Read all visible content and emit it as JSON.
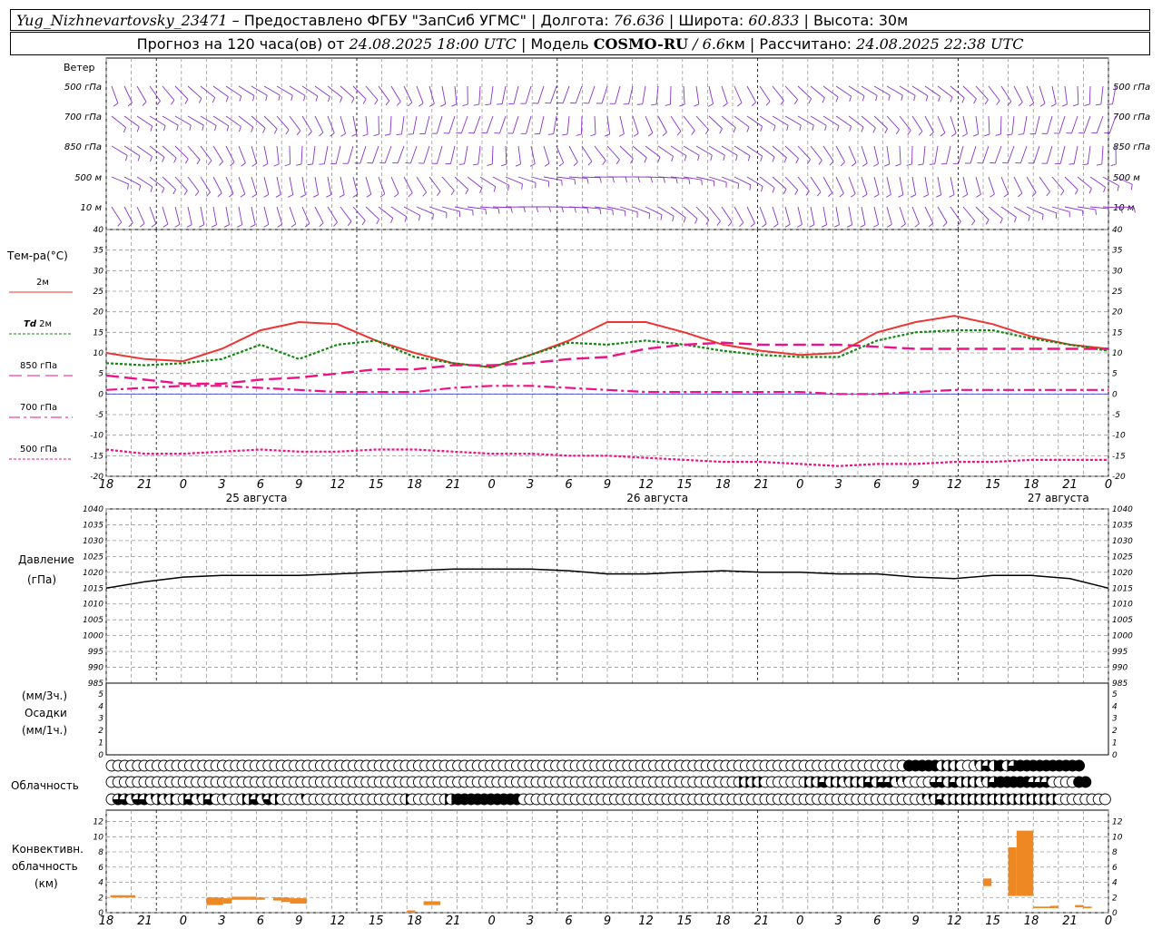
{
  "header": {
    "station": "Yug_Nizhnevartovsky_23471",
    "provider": " – Предоставлено ФГБУ \"ЗапСиб УГМС\" | Долгота: ",
    "lon": "76.636",
    "lat_label": " | Широта: ",
    "lat": "60.833",
    "alt_label": " | Высота: 30м",
    "forecast_label": "Прогноз на 120 часа(ов) от ",
    "forecast_time": "24.08.2025 18:00 UTC",
    "model_label": " | Модель ",
    "model": "COSMO-RU",
    "model_res": " / 6.6",
    "model_unit": "км",
    "calc_label": " | Рассчитано: ",
    "calc_time": "24.08.2025 22:38 UTC"
  },
  "labels": {
    "wind": "Ветер",
    "wind_levels": [
      "500 гПа",
      "700 гПа",
      "850 гПа",
      "500 м",
      "10 м"
    ],
    "temp_title": "Тем-ра(°С)",
    "t2m": "2м",
    "td_prefix": "Td",
    "td": "2м",
    "t850": "850 гПа",
    "t700": "700 гПа",
    "t500": "500 гПа",
    "pressure": "Давление",
    "pressure_unit": "(гПа)",
    "precip_unit3": "(мм/3ч.)",
    "precip": "Осадки",
    "precip_unit1": "(мм/1ч.)",
    "cloud": "Облачность",
    "conv1": "Конвективн.",
    "conv2": "облачность",
    "conv3": "(км)"
  },
  "colors": {
    "t2m": "#ee3333",
    "td": "#118811",
    "t850": "#ee1188",
    "t700": "#ee1188",
    "t500": "#ee1188",
    "wind": "#8833cc",
    "conv": "#ee8822",
    "pressure": "#000000"
  },
  "chart_data": [
    {
      "type": "line",
      "title": "Тем-ра(°С)",
      "time_hours": [
        18,
        21,
        0,
        3,
        6,
        9,
        12,
        15,
        18,
        21,
        0,
        3,
        6,
        9,
        12,
        15,
        18,
        21,
        0,
        3,
        6,
        9,
        12,
        15,
        18,
        21,
        0
      ],
      "x_tick_labels": [
        "18",
        "21",
        "0",
        "3",
        "6",
        "9",
        "12",
        "15",
        "18",
        "21",
        "0",
        "3",
        "6",
        "9",
        "12",
        "15",
        "18",
        "21",
        "0",
        "3",
        "6",
        "9",
        "12",
        "15",
        "18",
        "21",
        "0"
      ],
      "day_labels": [
        "25 августа",
        "26 августа",
        "27 августа"
      ],
      "ylim": [
        -20,
        40
      ],
      "yticks": [
        -20,
        -15,
        -10,
        -5,
        0,
        5,
        10,
        15,
        20,
        25,
        30,
        35,
        40
      ],
      "series": [
        {
          "name": "2м",
          "values": [
            10,
            8.5,
            8,
            11,
            15.5,
            17.5,
            17,
            13,
            10,
            7.5,
            6.5,
            9.5,
            13,
            17.5,
            17.5,
            15,
            12,
            10.5,
            9.5,
            10,
            15,
            17.5,
            19,
            17,
            14,
            12,
            11
          ]
        },
        {
          "name": "Td 2м",
          "values": [
            7.5,
            7,
            7.5,
            8.5,
            12,
            8.5,
            12,
            13,
            9,
            7.5,
            6.5,
            9.5,
            12.5,
            12,
            13,
            12,
            10.5,
            9.5,
            9,
            9,
            13,
            15,
            15.5,
            15.5,
            13.5,
            12,
            10.5
          ]
        },
        {
          "name": "850 гПа",
          "values": [
            4.5,
            3.5,
            2.5,
            2.5,
            3.5,
            4,
            5,
            6,
            6,
            7,
            7,
            7.5,
            8.5,
            9,
            11,
            12,
            12.5,
            12,
            12,
            12,
            11.5,
            11,
            11,
            11,
            11,
            11,
            11
          ]
        },
        {
          "name": "700 гПа",
          "values": [
            1,
            1.5,
            2,
            2,
            1.5,
            1,
            0.5,
            0.5,
            0.5,
            1.5,
            2,
            2,
            1.5,
            1,
            0.5,
            0.5,
            0.5,
            0.5,
            0.5,
            0,
            0,
            0.5,
            1,
            1,
            1,
            1,
            1
          ]
        },
        {
          "name": "500 гПа",
          "values": [
            -13.5,
            -14.5,
            -14.5,
            -14,
            -13.5,
            -14,
            -14,
            -13.5,
            -13.5,
            -14,
            -14.5,
            -14.5,
            -15,
            -15,
            -15.5,
            -16,
            -16.5,
            -16.5,
            -17,
            -17.5,
            -17,
            -17,
            -16.5,
            -16.5,
            -16,
            -16,
            -16
          ]
        }
      ]
    },
    {
      "type": "line",
      "title": "Давление",
      "ylabel": "(гПа)",
      "ylim": [
        985,
        1040
      ],
      "yticks": [
        985,
        990,
        995,
        1000,
        1005,
        1010,
        1015,
        1020,
        1025,
        1030,
        1035,
        1040
      ],
      "series": [
        {
          "values": [
            1015,
            1017,
            1018.5,
            1019,
            1019,
            1019,
            1019.5,
            1020,
            1020.5,
            1021,
            1021,
            1021,
            1020.5,
            1019.5,
            1019.5,
            1020,
            1020.5,
            1020,
            1020,
            1019.5,
            1019.5,
            1018.5,
            1018,
            1019,
            1019,
            1018,
            1015
          ]
        }
      ]
    },
    {
      "type": "bar",
      "title": "Осадки",
      "ylabel": "(мм/3ч.) (мм/1ч.)",
      "ylim": [
        0,
        5
      ],
      "yticks": [
        0,
        1,
        2,
        3,
        4,
        5
      ],
      "series": [
        {
          "values": []
        }
      ]
    },
    {
      "type": "table",
      "title": "Облачность",
      "rows": 3,
      "rows_cover_in_eighths": [
        [
          0,
          0,
          0,
          0,
          0,
          0,
          0,
          0,
          0,
          0,
          0,
          0,
          0,
          0,
          0,
          0,
          0,
          0,
          0,
          0,
          0,
          0,
          0,
          0,
          0,
          0,
          0,
          0,
          0,
          0,
          0,
          0,
          0,
          0,
          0,
          0,
          0,
          0,
          0,
          0,
          0,
          0,
          0,
          0,
          0,
          0,
          0,
          0,
          0,
          0,
          0,
          0,
          0,
          0,
          0,
          0,
          0,
          0,
          0,
          0,
          0,
          0,
          0,
          0,
          0,
          0,
          0,
          0,
          0,
          0,
          0,
          0,
          0,
          0,
          0,
          0,
          0,
          0,
          0,
          0,
          0,
          0,
          0,
          0,
          0,
          0,
          0,
          0,
          0,
          0,
          0,
          0,
          0,
          0,
          0,
          0,
          0,
          0,
          0,
          0,
          0,
          0,
          0,
          0,
          0,
          0,
          0,
          0,
          0,
          0,
          0,
          0,
          0,
          0,
          0,
          0,
          0,
          0,
          0,
          0,
          0,
          0,
          8,
          8,
          8,
          8,
          8,
          4,
          4,
          4,
          0,
          0,
          2,
          4,
          6,
          4,
          8,
          4,
          6,
          8,
          8,
          8,
          8,
          8,
          8,
          8,
          8,
          8,
          8
        ],
        [
          0,
          0,
          0,
          0,
          0,
          0,
          0,
          0,
          0,
          0,
          0,
          0,
          0,
          0,
          0,
          0,
          0,
          0,
          0,
          0,
          0,
          0,
          0,
          0,
          0,
          0,
          0,
          0,
          0,
          0,
          0,
          0,
          0,
          0,
          0,
          0,
          0,
          0,
          0,
          0,
          0,
          0,
          0,
          0,
          0,
          0,
          0,
          0,
          0,
          0,
          0,
          0,
          0,
          0,
          0,
          0,
          0,
          0,
          0,
          0,
          0,
          0,
          0,
          0,
          0,
          0,
          0,
          0,
          0,
          0,
          0,
          0,
          0,
          0,
          0,
          0,
          0,
          0,
          0,
          0,
          0,
          0,
          0,
          0,
          0,
          0,
          0,
          0,
          0,
          0,
          0,
          0,
          0,
          0,
          0,
          0,
          4,
          4,
          4,
          4,
          0,
          0,
          0,
          0,
          0,
          0,
          4,
          4,
          4,
          6,
          4,
          4,
          2,
          4,
          4,
          4,
          6,
          4,
          6,
          6,
          2,
          2,
          0,
          0,
          0,
          0,
          6,
          6,
          4,
          6,
          4,
          4,
          4,
          2,
          4,
          6,
          8,
          8,
          8,
          8,
          8,
          6,
          6,
          6,
          0,
          0,
          0,
          0,
          8,
          8
        ],
        [
          0,
          6,
          6,
          2,
          6,
          6,
          2,
          4,
          2,
          4,
          0,
          4,
          6,
          2,
          4,
          6,
          0,
          2,
          0,
          0,
          4,
          4,
          6,
          2,
          6,
          4,
          0,
          0,
          0,
          2,
          0,
          0,
          0,
          0,
          0,
          0,
          0,
          0,
          0,
          0,
          0,
          0,
          0,
          0,
          0,
          4,
          0,
          0,
          0,
          0,
          0,
          4,
          4,
          8,
          8,
          8,
          8,
          8,
          8,
          8,
          8,
          8,
          8,
          0,
          0,
          0,
          0,
          0,
          0,
          0,
          0,
          0,
          0,
          0,
          0,
          0,
          0,
          0,
          0,
          0,
          0,
          0,
          0,
          0,
          0,
          0,
          0,
          0,
          0,
          0,
          0,
          0,
          0,
          0,
          0,
          0,
          0,
          0,
          0,
          0,
          0,
          0,
          0,
          0,
          0,
          0,
          0,
          0,
          0,
          0,
          0,
          0,
          0,
          0,
          0,
          0,
          0,
          0,
          0,
          0,
          0,
          0,
          0,
          0,
          2,
          2,
          4,
          6,
          4,
          4,
          4,
          4,
          4,
          4,
          4,
          4,
          4,
          4,
          4,
          4,
          4,
          4,
          4,
          4,
          4,
          0,
          0,
          0,
          0,
          0,
          0,
          0,
          0,
          0,
          0,
          4,
          2,
          2
        ]
      ]
    },
    {
      "type": "bar",
      "title": "Конвективн. облачность",
      "ylabel": "(км)",
      "ylim": [
        0,
        13
      ],
      "yticks": [
        0,
        2,
        4,
        6,
        8,
        10,
        12
      ],
      "bars": [
        {
          "t0": 0.5,
          "t1": 3.5,
          "base": 2.0,
          "top": 2.3
        },
        {
          "t0": 12.0,
          "t1": 14.0,
          "base": 1.0,
          "top": 2.0
        },
        {
          "t0": 14.0,
          "t1": 15.0,
          "base": 1.2,
          "top": 1.9
        },
        {
          "t0": 15.0,
          "t1": 17.0,
          "base": 1.7,
          "top": 2.1
        },
        {
          "t0": 17.0,
          "t1": 18.0,
          "base": 1.7,
          "top": 2.1
        },
        {
          "t0": 18.0,
          "t1": 19.0,
          "base": 1.7,
          "top": 2.0
        },
        {
          "t0": 20.0,
          "t1": 21.0,
          "base": 1.6,
          "top": 2.0
        },
        {
          "t0": 21.0,
          "t1": 22.0,
          "base": 1.4,
          "top": 2.0
        },
        {
          "t0": 22.0,
          "t1": 24.0,
          "base": 1.2,
          "top": 1.9
        },
        {
          "t0": 36.0,
          "t1": 37.0,
          "base": 0.0,
          "top": 0.3
        },
        {
          "t0": 38.0,
          "t1": 40.0,
          "base": 1.0,
          "top": 1.5
        },
        {
          "t0": 105.0,
          "t1": 106.0,
          "base": 3.5,
          "top": 4.5
        },
        {
          "t0": 108.0,
          "t1": 109.0,
          "base": 2.2,
          "top": 8.6
        },
        {
          "t0": 109.0,
          "t1": 111.0,
          "base": 2.2,
          "top": 10.8
        },
        {
          "t0": 111.0,
          "t1": 113.0,
          "base": 0.6,
          "top": 0.8
        },
        {
          "t0": 113.0,
          "t1": 114.0,
          "base": 0.6,
          "top": 0.9
        },
        {
          "t0": 116.0,
          "t1": 117.0,
          "base": 0.7,
          "top": 1.0
        },
        {
          "t0": 117.0,
          "t1": 118.0,
          "base": 0.6,
          "top": 0.8
        }
      ]
    }
  ]
}
